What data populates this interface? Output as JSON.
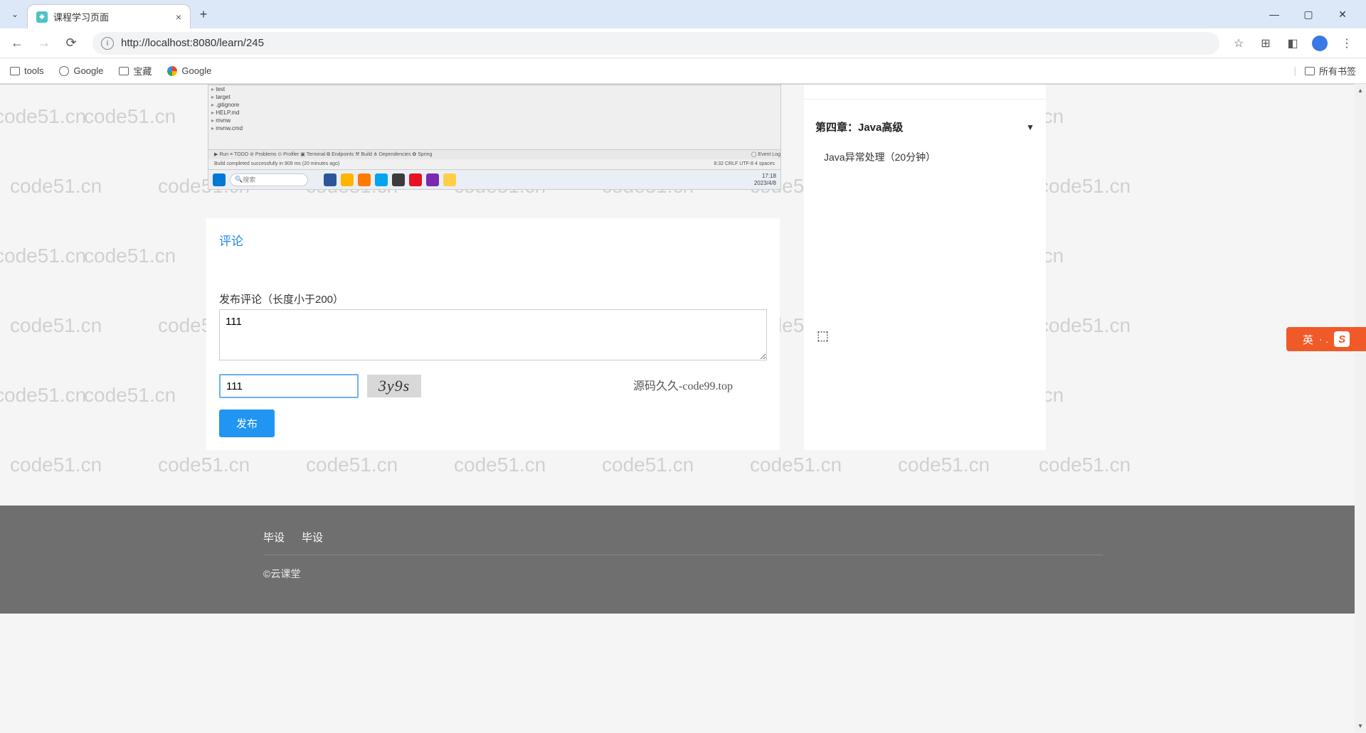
{
  "browser": {
    "tab_title": "课程学习页面",
    "url": "http://localhost:8080/learn/245",
    "new_tab": "+",
    "close_tab": "×",
    "dropdown": "⌄"
  },
  "window_controls": {
    "min": "—",
    "max": "▢",
    "close": "✕"
  },
  "bookmarks": {
    "items": [
      "tools",
      "Google",
      "宝藏",
      "Google"
    ],
    "all": "所有书签"
  },
  "watermark_text": "code51.cn",
  "video_overlay": "源码久久-code99.top",
  "ide": {
    "tree": [
      "test",
      "target",
      ".gitignore",
      "HELP.md",
      "mvnw",
      "mvnw.cmd"
    ],
    "tabs": "▶ Run   ≡ TODO   ⊘ Problems   ⊙ Profiler   ▣ Terminal   ⧉ Endpoints   ⚒ Build   ⋔ Dependencies   ✿ Spring",
    "status_left": "Build completed successfully in 909 ms (20 minutes ago)",
    "status_right": "8:32  CRLF  UTF-8  4 spaces",
    "event_log": "◯ Event Log",
    "taskbar_search": "搜索",
    "taskbar_time": "17:18",
    "taskbar_date": "2023/4/8"
  },
  "comment": {
    "tab_label": "评论",
    "label": "发布评论（长度小于200）",
    "textarea_value": "111",
    "captcha_value": "111",
    "captcha_text": "3y9s",
    "publish": "发布"
  },
  "sidebar": {
    "chapter_title": "第四章：Java高级",
    "chapter_arrow": "▼",
    "lesson": "Java异常处理（20分钟）"
  },
  "footer": {
    "link1": "毕设",
    "link2": "毕设",
    "copy": "©云课堂"
  },
  "ime": {
    "lang": "英",
    "dots": "· .",
    "brand": "S"
  }
}
